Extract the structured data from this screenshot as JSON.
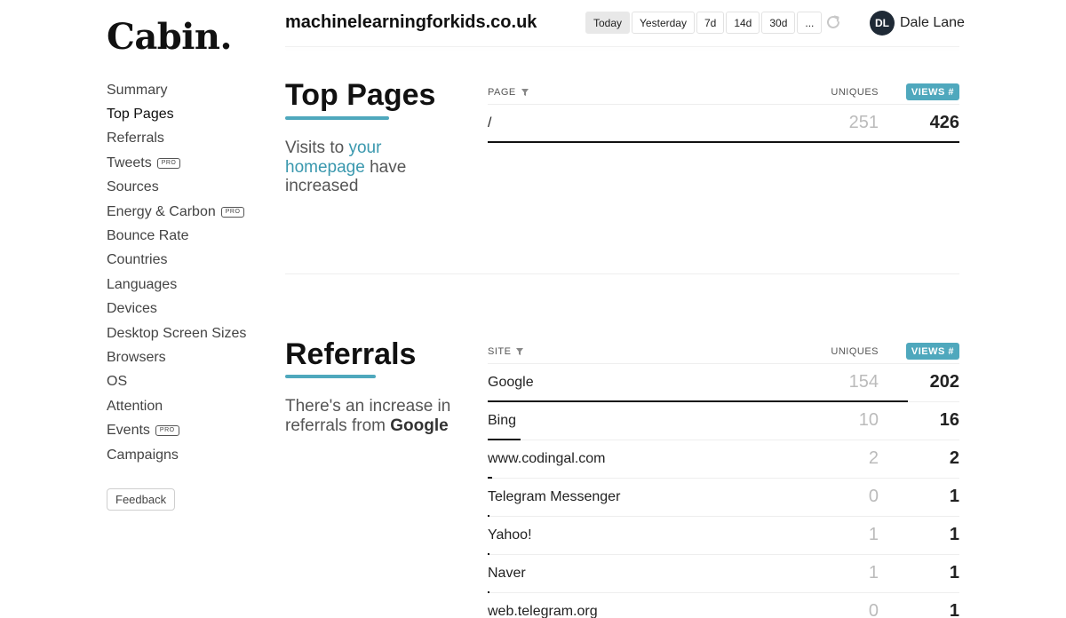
{
  "brand": {
    "logo": "Cabin."
  },
  "sidebar": {
    "items": [
      {
        "label": "Summary",
        "pro": false
      },
      {
        "label": "Top Pages",
        "pro": false
      },
      {
        "label": "Referrals",
        "pro": false
      },
      {
        "label": "Tweets",
        "pro": true
      },
      {
        "label": "Sources",
        "pro": false
      },
      {
        "label": "Energy & Carbon",
        "pro": true
      },
      {
        "label": "Bounce Rate",
        "pro": false
      },
      {
        "label": "Countries",
        "pro": false
      },
      {
        "label": "Languages",
        "pro": false
      },
      {
        "label": "Devices",
        "pro": false
      },
      {
        "label": "Desktop Screen Sizes",
        "pro": false
      },
      {
        "label": "Browsers",
        "pro": false
      },
      {
        "label": "OS",
        "pro": false
      },
      {
        "label": "Attention",
        "pro": false
      },
      {
        "label": "Events",
        "pro": true
      },
      {
        "label": "Campaigns",
        "pro": false
      }
    ],
    "pro_label": "PRO",
    "feedback_label": "Feedback"
  },
  "header": {
    "site": "machinelearningforkids.co.uk",
    "ranges": [
      "Today",
      "Yesterday",
      "7d",
      "14d",
      "30d",
      "..."
    ],
    "active_range": "Today",
    "user": {
      "initials": "DL",
      "name": "Dale Lane"
    }
  },
  "top_pages": {
    "title": "Top Pages",
    "blurb": {
      "pre": "Visits to",
      "highlight": "your homepage",
      "post": "have increased"
    },
    "columns": {
      "key": "PAGE",
      "uniques": "UNIQUES",
      "views": "VIEWS #"
    },
    "rows": [
      {
        "label": "/",
        "uniques": 251,
        "views": 426
      }
    ]
  },
  "referrals": {
    "title": "Referrals",
    "blurb": {
      "pre": "There's an increase in referrals from",
      "strong": "Google"
    },
    "columns": {
      "key": "SITE",
      "uniques": "UNIQUES",
      "views": "VIEWS #"
    },
    "rows": [
      {
        "label": "Google",
        "uniques": 154,
        "views": 202
      },
      {
        "label": "Bing",
        "uniques": 10,
        "views": 16
      },
      {
        "label": "www.codingal.com",
        "uniques": 2,
        "views": 2
      },
      {
        "label": "Telegram Messenger",
        "uniques": 0,
        "views": 1
      },
      {
        "label": "Yahoo!",
        "uniques": 1,
        "views": 1
      },
      {
        "label": "Naver",
        "uniques": 1,
        "views": 1
      },
      {
        "label": "web.telegram.org",
        "uniques": 0,
        "views": 1
      }
    ]
  }
}
